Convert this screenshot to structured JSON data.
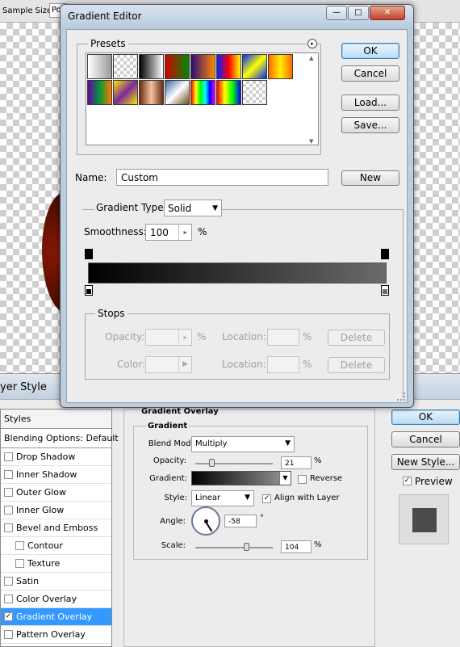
{
  "background_toolbar": {
    "sample_size_label": "Sample Size:",
    "sample_size_value": "Po"
  },
  "layer_style": {
    "title": "yer Style",
    "list": {
      "styles": "Styles",
      "blending": "Blending Options: Default",
      "items": [
        {
          "label": "Drop Shadow",
          "checked": false,
          "sub": false
        },
        {
          "label": "Inner Shadow",
          "checked": false,
          "sub": false
        },
        {
          "label": "Outer Glow",
          "checked": false,
          "sub": false
        },
        {
          "label": "Inner Glow",
          "checked": false,
          "sub": false
        },
        {
          "label": "Bevel and Emboss",
          "checked": false,
          "sub": false
        },
        {
          "label": "Contour",
          "checked": false,
          "sub": true
        },
        {
          "label": "Texture",
          "checked": false,
          "sub": true
        },
        {
          "label": "Satin",
          "checked": false,
          "sub": false
        },
        {
          "label": "Color Overlay",
          "checked": false,
          "sub": false
        },
        {
          "label": "Gradient Overlay",
          "checked": true,
          "sub": false,
          "active": true
        },
        {
          "label": "Pattern Overlay",
          "checked": false,
          "sub": false
        }
      ]
    },
    "panel": {
      "title": "Gradient Overlay",
      "group": "Gradient",
      "blend_mode_label": "Blend Mode:",
      "blend_mode_value": "Multiply",
      "opacity_label": "Opacity:",
      "opacity_value": "21",
      "opacity_unit": "%",
      "opacity_fraction": 0.21,
      "gradient_label": "Gradient:",
      "reverse_label": "Reverse",
      "reverse_checked": false,
      "style_label": "Style:",
      "style_value": "Linear",
      "align_label": "Align with Layer",
      "align_checked": true,
      "angle_label": "Angle:",
      "angle_value": "-58",
      "angle_unit": "°",
      "scale_label": "Scale:",
      "scale_value": "104",
      "scale_unit": "%"
    },
    "buttons": {
      "ok": "OK",
      "cancel": "Cancel",
      "new_style": "New Style...",
      "preview": "Preview"
    },
    "preview_checked": true
  },
  "gradient_editor": {
    "title": "Gradient Editor",
    "window_buttons": {
      "minimize": "—",
      "maximize": "□",
      "close": "✕"
    },
    "presets_label": "Presets",
    "presets_menu_icon": "▸",
    "presets": [
      {
        "name": "white-gray",
        "colors": [
          "#ffffff",
          "#9a9a9a"
        ]
      },
      {
        "name": "transparent-checker",
        "colors": [
          "#dcdcdc",
          "#ffffff"
        ]
      },
      {
        "name": "black-white",
        "colors": [
          "#000000",
          "#ffffff"
        ]
      },
      {
        "name": "red-green",
        "colors": [
          "#d40000",
          "#008a00"
        ]
      },
      {
        "name": "violet-orange",
        "colors": [
          "#2a0a7a",
          "#ff8a00"
        ]
      },
      {
        "name": "blue-red-yellow",
        "colors": [
          "#0022ff",
          "#ff0000",
          "#ffff00"
        ]
      },
      {
        "name": "blue-yellow-blue",
        "colors": [
          "#0028ff",
          "#ffff00",
          "#0028ff"
        ]
      },
      {
        "name": "orange-yellow-orange",
        "colors": [
          "#ff6a00",
          "#ffee00",
          "#ff6a00"
        ]
      },
      {
        "name": "violet-green-orange",
        "colors": [
          "#6a00a0",
          "#009a3a",
          "#ff7a00"
        ]
      },
      {
        "name": "yellow-violet-stripes",
        "colors": [
          "#ffe600",
          "#7a2a9a",
          "#ffe600"
        ]
      },
      {
        "name": "copper",
        "colors": [
          "#6b2a12",
          "#f3c3a1",
          "#6b2a12"
        ]
      },
      {
        "name": "chrome",
        "colors": [
          "#3a66a0",
          "#ffffff",
          "#6b4a1a"
        ]
      },
      {
        "name": "spectrum",
        "colors": [
          "#ff0000",
          "#ffff00",
          "#00ff00",
          "#00ffff",
          "#0000ff",
          "#ff00ff"
        ]
      },
      {
        "name": "transparent-rainbow",
        "colors": [
          "#ff0000",
          "#ffff00",
          "#00ff00",
          "#0000ff"
        ]
      },
      {
        "name": "transparent-stripes",
        "colors": [
          "#ffffff",
          "#c0c0c0"
        ]
      }
    ],
    "buttons": {
      "ok": "OK",
      "cancel": "Cancel",
      "load": "Load...",
      "save": "Save...",
      "new": "New",
      "delete": "Delete"
    },
    "name_label": "Name:",
    "name_value": "Custom",
    "gradient_type_label": "Gradient Type:",
    "gradient_type_value": "Solid",
    "smoothness_label": "Smoothness:",
    "smoothness_value": "100",
    "smoothness_unit": "%",
    "gradient_colors": [
      "#000000",
      "#6b6b6b"
    ],
    "stops_label": "Stops",
    "opacity_label": "Opacity:",
    "color_label": "Color:",
    "location_label": "Location:",
    "percent": "%"
  }
}
